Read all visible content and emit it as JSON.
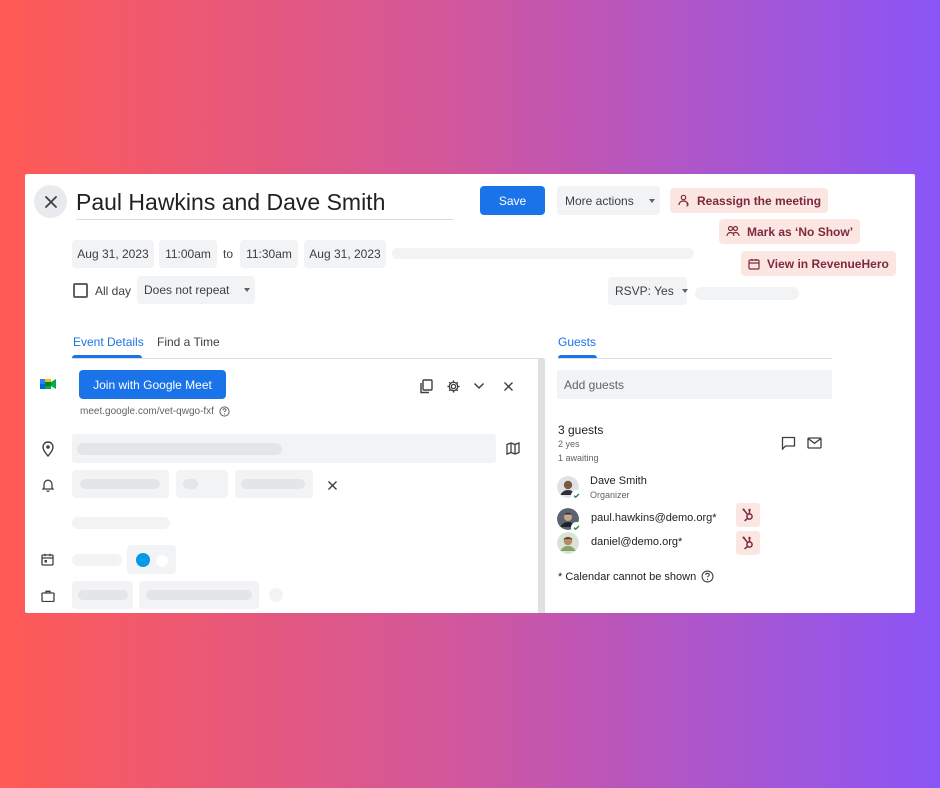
{
  "event": {
    "title": "Paul Hawkins and Dave Smith",
    "start_date": "Aug 31, 2023",
    "start_time": "11:00am",
    "to_label": "to",
    "end_time": "11:30am",
    "end_date": "Aug 31, 2023",
    "all_day_label": "All day",
    "repeat_value": "Does not repeat",
    "rsvp_value": "RSVP: Yes"
  },
  "toolbar": {
    "save_label": "Save",
    "more_actions_label": "More actions"
  },
  "revenuehero": {
    "reassign_label": "Reassign the meeting",
    "no_show_label": "Mark as ‘No Show’",
    "view_label": "View in RevenueHero",
    "accent_color": "#7d2940",
    "background_color": "#fbe6e2"
  },
  "tabs": {
    "event_details": "Event Details",
    "find_a_time": "Find a Time",
    "guests": "Guests"
  },
  "meet": {
    "join_label": "Join with Google Meet",
    "link": "meet.google.com/vet-qwgo-fxf"
  },
  "guests": {
    "add_placeholder": "Add guests",
    "count_label": "3 guests",
    "yes_label": "2 yes",
    "awaiting_label": "1 awaiting",
    "list": [
      {
        "name": "Dave Smith",
        "role": "Organizer"
      },
      {
        "name": "paul.hawkins@demo.org*",
        "role": ""
      },
      {
        "name": "daniel@demo.org*",
        "role": ""
      }
    ],
    "calendar_note": "* Calendar cannot be shown"
  },
  "colors": {
    "primary": "#1a73e8",
    "toggle": "#039be5"
  }
}
